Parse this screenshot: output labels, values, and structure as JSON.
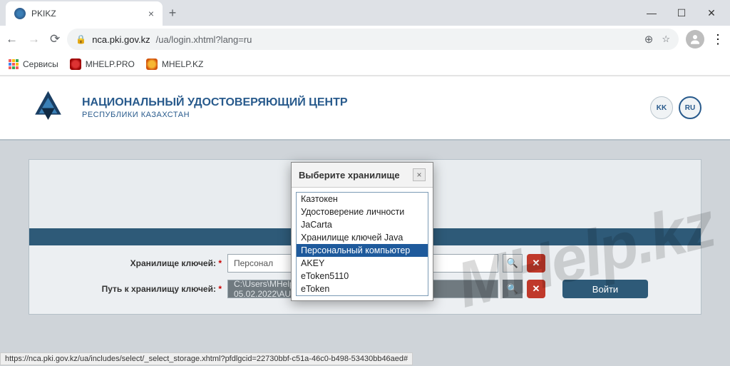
{
  "browser": {
    "tab_title": "PKIKZ",
    "url_host": "nca.pki.gov.kz",
    "url_path": "/ua/login.xhtml?lang=ru",
    "bookmarks": {
      "apps": "Сервисы",
      "b1": "MHELP.PRO",
      "b2": "MHELP.KZ"
    }
  },
  "header": {
    "title": "НАЦИОНАЛЬНЫЙ УДОСТОВЕРЯЮЩИЙ ЦЕНТР",
    "subtitle": "РЕСПУБЛИКИ КАЗАХСТАН",
    "lang_kk": "KK",
    "lang_ru": "RU"
  },
  "form": {
    "row1_label": "Хранилище ключей:",
    "row1_value": "Персонал",
    "row2_label": "Путь к хранилищу ключей:",
    "row2_value": "C:\\Users\\MHelp.pro\\Desktop\\ЭЦП до 05.02.2022\\AUTH_RSA256_e9a55e0a",
    "login_btn": "Войти"
  },
  "modal": {
    "title": "Выберите хранилище",
    "options": [
      "Казтокен",
      "Удостоверение личности",
      "JaCarta",
      "Хранилище ключей Java",
      "Персональный компьютер",
      "AKEY",
      "eToken5110",
      "eToken"
    ],
    "selected_index": 4
  },
  "status_bar": "https://nca.pki.gov.kz/ua/includes/select/_select_storage.xhtml?pfdlgcid=22730bbf-c51a-46c0-b498-53430bb46aed#",
  "watermark": "MHelp.kz"
}
